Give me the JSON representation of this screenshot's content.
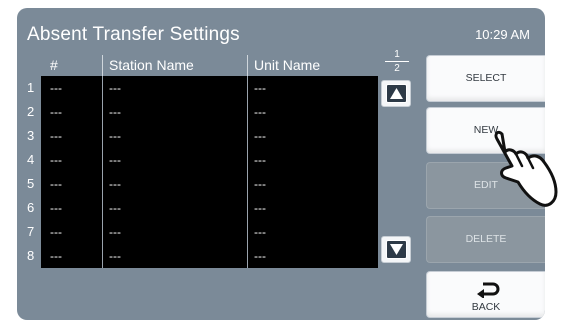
{
  "header": {
    "title": "Absent Transfer Settings",
    "time": "10:29 AM"
  },
  "table": {
    "columns": [
      "#",
      "Station Name",
      "Unit Name"
    ],
    "rows": [
      {
        "index": "1",
        "number": "---",
        "station": "---",
        "unit": "---"
      },
      {
        "index": "2",
        "number": "---",
        "station": "---",
        "unit": "---"
      },
      {
        "index": "3",
        "number": "---",
        "station": "---",
        "unit": "---"
      },
      {
        "index": "4",
        "number": "---",
        "station": "---",
        "unit": "---"
      },
      {
        "index": "5",
        "number": "---",
        "station": "---",
        "unit": "---"
      },
      {
        "index": "6",
        "number": "---",
        "station": "---",
        "unit": "---"
      },
      {
        "index": "7",
        "number": "---",
        "station": "---",
        "unit": "---"
      },
      {
        "index": "8",
        "number": "---",
        "station": "---",
        "unit": "---"
      }
    ]
  },
  "pagination": {
    "current": "1",
    "total": "2"
  },
  "buttons": {
    "select": "SELECT",
    "new": "NEW",
    "edit": "EDIT",
    "delete": "DELETE",
    "back": "BACK"
  },
  "icons": {
    "scroll_up": "up-arrow-icon",
    "scroll_down": "down-arrow-icon",
    "back": "return-arrow-icon",
    "pointer": "pointing-hand-icon"
  },
  "colors": {
    "panel_bg": "#7b8a98",
    "list_bg": "#000000",
    "button_bg": "#fafbfc",
    "button_disabled_bg": "#8b969f"
  }
}
